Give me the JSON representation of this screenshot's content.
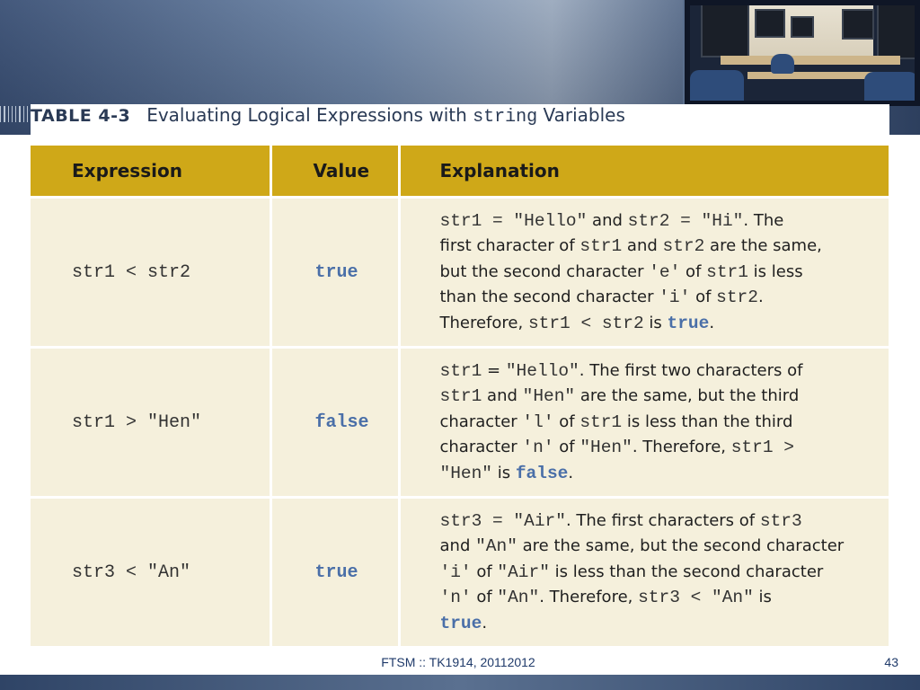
{
  "table": {
    "number": "TABLE 4-3",
    "caption_before": "Evaluating Logical Expressions with ",
    "caption_code": "string",
    "caption_after": " Variables",
    "headers": [
      "Expression",
      "Value",
      "Explanation"
    ],
    "rows": [
      {
        "expression": "str1 < str2",
        "value": "true",
        "explanation": [
          [
            [
              "m",
              "str1 = \"Hello\""
            ],
            [
              "t",
              " and "
            ],
            [
              "m",
              "str2 = \"Hi\""
            ],
            [
              "t",
              ". The"
            ]
          ],
          [
            [
              "t",
              "first character of "
            ],
            [
              "m",
              "str1"
            ],
            [
              "t",
              " and "
            ],
            [
              "m",
              "str2"
            ],
            [
              "t",
              " are the same,"
            ]
          ],
          [
            [
              "t",
              "but the second character "
            ],
            [
              "m",
              "'e'"
            ],
            [
              "t",
              " of "
            ],
            [
              "m",
              "str1"
            ],
            [
              "t",
              " is less"
            ]
          ],
          [
            [
              "t",
              "than the second character "
            ],
            [
              "m",
              "'i'"
            ],
            [
              "t",
              " of "
            ],
            [
              "m",
              "str2"
            ],
            [
              "t",
              "."
            ]
          ],
          [
            [
              "t",
              "Therefore, "
            ],
            [
              "m",
              "str1 < str2"
            ],
            [
              "t",
              " is "
            ],
            [
              "k",
              "true"
            ],
            [
              "t",
              "."
            ]
          ]
        ]
      },
      {
        "expression": "str1 > \"Hen\"",
        "value": "false",
        "explanation": [
          [
            [
              "m",
              "str1"
            ],
            [
              "t",
              " = "
            ],
            [
              "m",
              "\"Hello\""
            ],
            [
              "t",
              ". The first two characters of"
            ]
          ],
          [
            [
              "m",
              "str1"
            ],
            [
              "t",
              " and "
            ],
            [
              "m",
              "\"Hen\""
            ],
            [
              "t",
              " are the same, but the third"
            ]
          ],
          [
            [
              "t",
              "character "
            ],
            [
              "m",
              "'l'"
            ],
            [
              "t",
              " of "
            ],
            [
              "m",
              "str1"
            ],
            [
              "t",
              " is less than the third"
            ]
          ],
          [
            [
              "t",
              "character "
            ],
            [
              "m",
              "'n'"
            ],
            [
              "t",
              " of "
            ],
            [
              "m",
              "\"Hen\""
            ],
            [
              "t",
              ". Therefore, "
            ],
            [
              "m",
              "str1 >"
            ]
          ],
          [
            [
              "m",
              "\"Hen\""
            ],
            [
              "t",
              " is "
            ],
            [
              "k",
              "false"
            ],
            [
              "t",
              "."
            ]
          ]
        ]
      },
      {
        "expression": "str3 < \"An\"",
        "value": "true",
        "explanation": [
          [
            [
              "m",
              "str3 = \"Air\""
            ],
            [
              "t",
              ". The first characters of "
            ],
            [
              "m",
              "str3"
            ]
          ],
          [
            [
              "t",
              "and "
            ],
            [
              "m",
              "\"An\""
            ],
            [
              "t",
              " are the same, but the second character"
            ]
          ],
          [
            [
              "m",
              "'i'"
            ],
            [
              "t",
              " of "
            ],
            [
              "m",
              "\"Air\""
            ],
            [
              "t",
              " is less than the second character"
            ]
          ],
          [
            [
              "m",
              "'n'"
            ],
            [
              "t",
              " of "
            ],
            [
              "m",
              "\"An\""
            ],
            [
              "t",
              ". Therefore, "
            ],
            [
              "m",
              "str3 < \"An\""
            ],
            [
              "t",
              " is"
            ]
          ],
          [
            [
              "k",
              "true"
            ],
            [
              "t",
              "."
            ]
          ]
        ]
      }
    ]
  },
  "footer": {
    "course": "FTSM :: TK1914, 20112012",
    "page_number": "43"
  },
  "colors": {
    "header_gold": "#cfa818",
    "row_cream": "#f5f0dc",
    "keyword_blue": "#4a6fa8",
    "banner_blue": "#3a5075"
  },
  "decorations": {
    "classroom_photo": "computer-lab-photo"
  }
}
